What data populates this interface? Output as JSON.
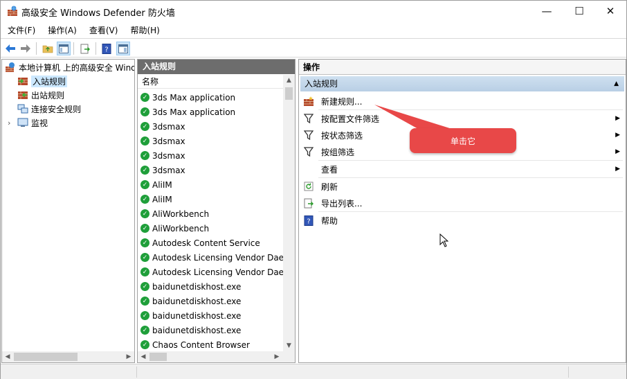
{
  "window": {
    "title": "高级安全 Windows Defender 防火墙",
    "minimize": "—",
    "maximize": "☐",
    "close": "✕"
  },
  "menu": [
    "文件(F)",
    "操作(A)",
    "查看(V)",
    "帮助(H)"
  ],
  "toolbar": {
    "icons": [
      "back-arrow-icon",
      "forward-arrow-icon",
      "folder-up-icon",
      "show-hide-tree-icon",
      "export-icon",
      "help-icon",
      "properties-icon"
    ]
  },
  "tree": {
    "root": "本地计算机 上的高级安全 Windows Defender 防火墙",
    "items": [
      "入站规则",
      "出站规则",
      "连接安全规则",
      "监视"
    ]
  },
  "list": {
    "header": "入站规则",
    "column": "名称",
    "rows": [
      "3ds Max application",
      "3ds Max application",
      "3dsmax",
      "3dsmax",
      "3dsmax",
      "3dsmax",
      "AliIM",
      "AliIM",
      "AliWorkbench",
      "AliWorkbench",
      "Autodesk Content Service",
      "Autodesk Licensing Vendor Daemon",
      "Autodesk Licensing Vendor Daemon",
      "baidunetdiskhost.exe",
      "baidunetdiskhost.exe",
      "baidunetdiskhost.exe",
      "baidunetdiskhost.exe",
      "Chaos Content Browser"
    ]
  },
  "actions": {
    "title": "操作",
    "section": "入站规则",
    "items": [
      {
        "label": "新建规则...",
        "icon": "new-rule-icon",
        "submenu": false
      },
      {
        "label": "按配置文件筛选",
        "icon": "filter-icon",
        "submenu": true
      },
      {
        "label": "按状态筛选",
        "icon": "filter-icon",
        "submenu": true
      },
      {
        "label": "按组筛选",
        "icon": "filter-icon",
        "submenu": true
      },
      {
        "label": "查看",
        "icon": "",
        "submenu": true
      },
      {
        "label": "刷新",
        "icon": "refresh-icon",
        "submenu": false
      },
      {
        "label": "导出列表...",
        "icon": "export-list-icon",
        "submenu": false
      },
      {
        "label": "帮助",
        "icon": "help-icon",
        "submenu": false
      }
    ]
  },
  "callout": {
    "text": "单击它",
    "color": "#e84848"
  },
  "colors": {
    "selection": "#cce8ff",
    "pane_header": "#6d6d6d",
    "section_bar": "#c4d7ea",
    "check_green": "#1f9f3a"
  }
}
